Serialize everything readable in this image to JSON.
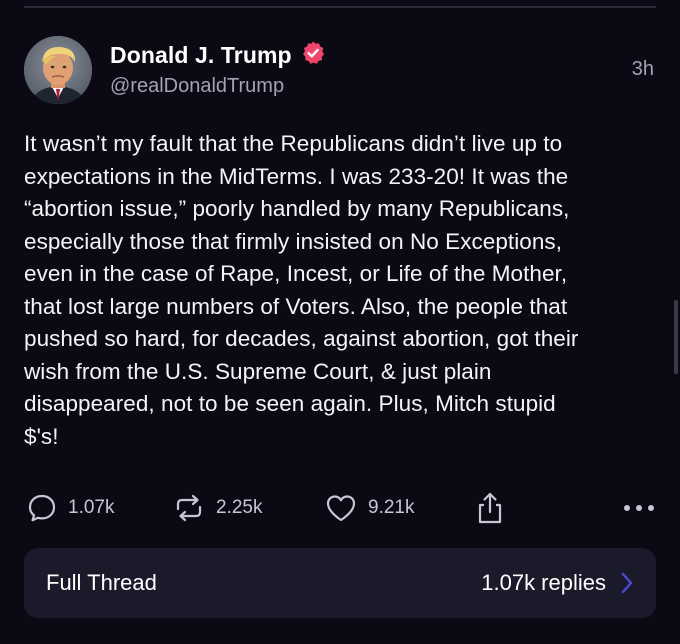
{
  "author": {
    "display_name": "Donald J. Trump",
    "handle": "@realDonaldTrump",
    "verified": true,
    "verified_color": "#f0466b",
    "avatar": "profile-photo"
  },
  "timestamp": "3h",
  "post": {
    "text": "It wasn’t my fault that the Republicans didn’t live up to\nexpectations in the MidTerms. I was 233-20! It was the\n“abortion issue,” poorly handled by many Republicans,\nespecially those that firmly insisted on No Exceptions,\neven in the case of Rape, Incest, or Life of the Mother,\nthat lost large numbers of Voters. Also, the people that\npushed so hard, for decades, against abortion, got their\nwish from the U.S. Supreme Court, & just plain\ndisappeared, not to be seen again. Plus, Mitch stupid\n$'s!"
  },
  "actions": {
    "replies": {
      "icon": "reply-bubble-icon",
      "count": "1.07k"
    },
    "retruths": {
      "icon": "repost-icon",
      "count": "2.25k"
    },
    "likes": {
      "icon": "heart-icon",
      "count": "9.21k"
    },
    "share": {
      "icon": "share-icon"
    },
    "more": {
      "icon": "more-horizontal-icon"
    }
  },
  "thread": {
    "label": "Full Thread",
    "replies": "1.07k replies",
    "chevron_color": "#4b4bd6"
  },
  "colors": {
    "background": "#0b0a14",
    "card": "#1b1a2b",
    "muted_text": "#a3a1b3"
  }
}
